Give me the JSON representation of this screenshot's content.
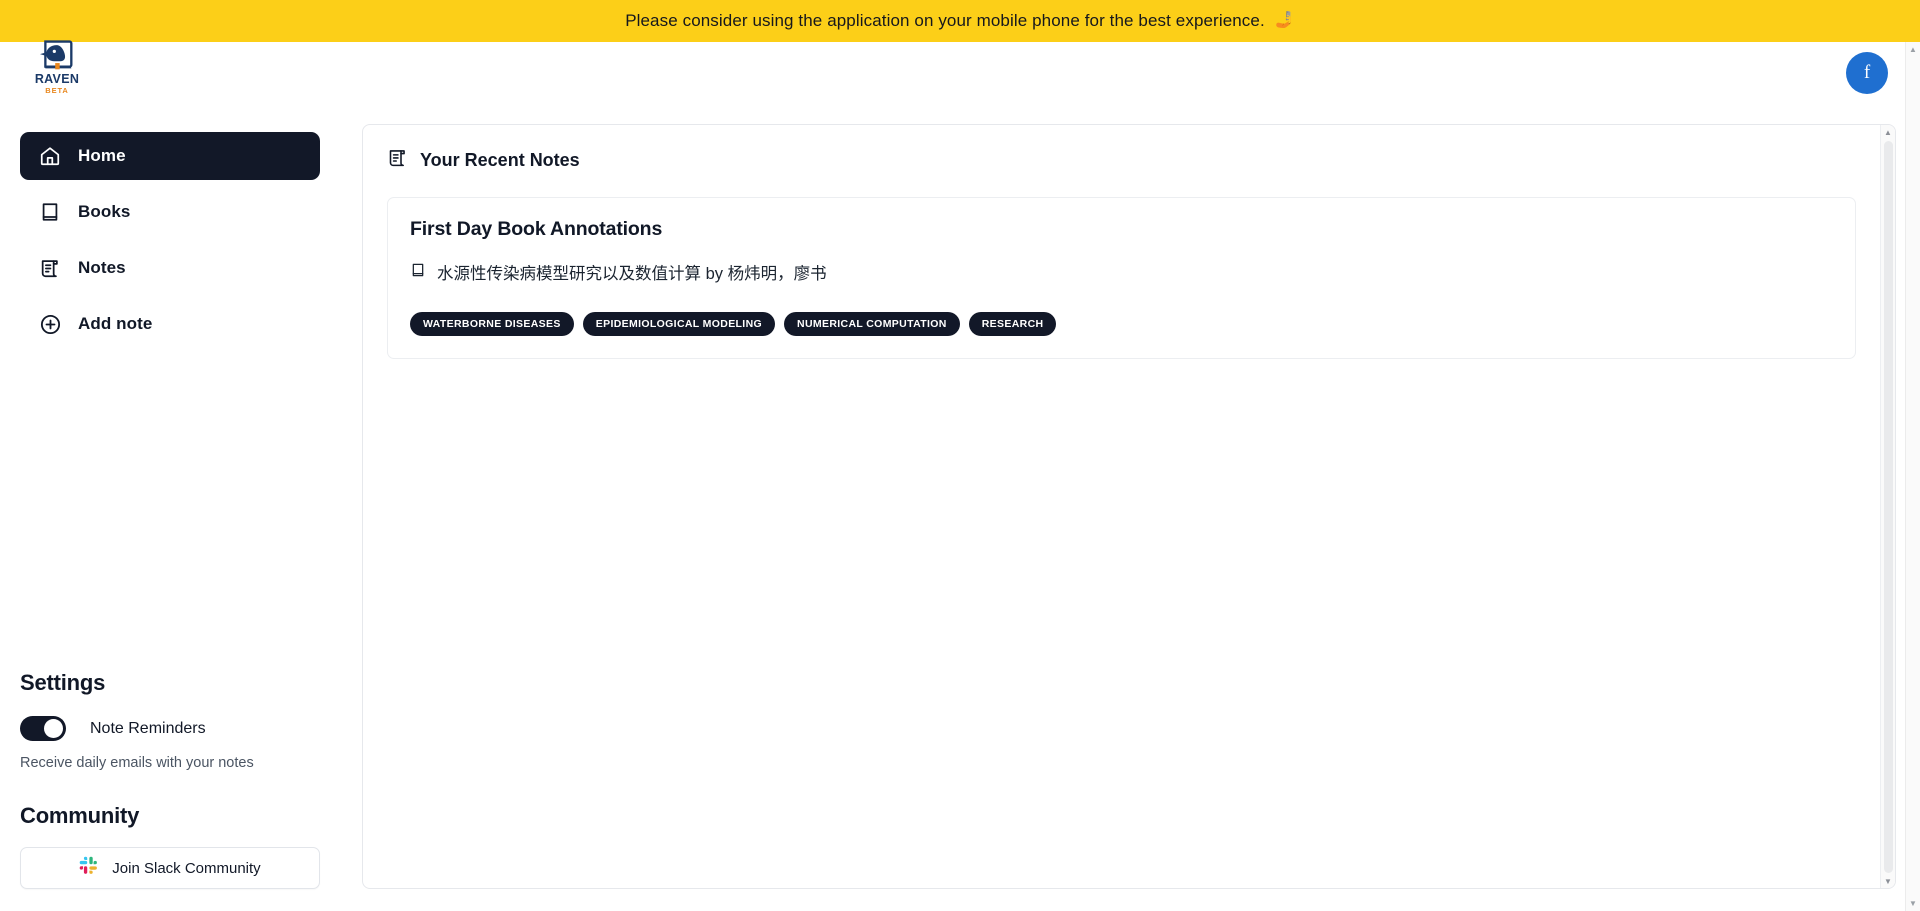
{
  "banner": {
    "message": "Please consider using the application on your mobile phone for the best experience.",
    "emoji": "🤳"
  },
  "header": {
    "logo": {
      "icon": "raven-book-logo",
      "wordmark": "RAVEN",
      "badge": "BETA"
    },
    "avatar": {
      "initial": "f",
      "color": "#1f6fd0"
    }
  },
  "sidebar": {
    "nav": [
      {
        "label": "Home",
        "icon": "home-icon",
        "active": true
      },
      {
        "label": "Books",
        "icon": "book-icon",
        "active": false
      },
      {
        "label": "Notes",
        "icon": "scroll-icon",
        "active": false
      },
      {
        "label": "Add note",
        "icon": "plus-circle-icon",
        "active": false
      }
    ],
    "settings": {
      "title": "Settings",
      "toggle_label": "Note Reminders",
      "toggle_on": true,
      "hint": "Receive daily emails with your notes"
    },
    "community": {
      "title": "Community",
      "button_label": "Join Slack Community",
      "button_icon": "slack-icon"
    }
  },
  "main": {
    "section": {
      "icon": "scroll-icon",
      "title": "Your Recent Notes"
    },
    "notes": [
      {
        "title": "First Day Book Annotations",
        "book_icon": "book-icon",
        "book_line": "水源性传染病模型研究以及数值计算 by 杨炜明，廖书",
        "tags": [
          "WATERBORNE DISEASES",
          "EPIDEMIOLOGICAL MODELING",
          "NUMERICAL COMPUTATION",
          "RESEARCH"
        ]
      }
    ]
  },
  "colors": {
    "banner_bg": "#fccf18",
    "accent_dark": "#121828",
    "logo_blue": "#1b3a68",
    "logo_orange": "#e8871e"
  }
}
